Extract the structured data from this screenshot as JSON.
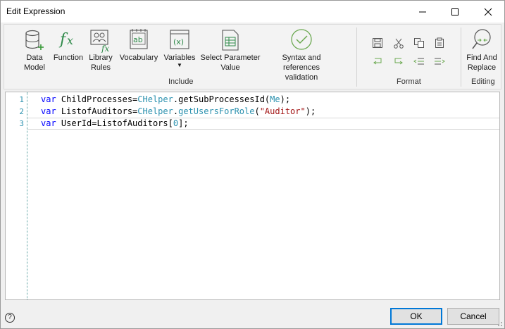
{
  "window": {
    "title": "Edit Expression"
  },
  "ribbon": {
    "include": {
      "group_label": "Include",
      "buttons": [
        {
          "label": "Data\nModel",
          "icon": "database-icon"
        },
        {
          "label": "Function",
          "icon": "function-fx-icon"
        },
        {
          "label": "Library\nRules",
          "icon": "library-rules-icon"
        },
        {
          "label": "Vocabulary",
          "icon": "vocabulary-icon"
        },
        {
          "label": "Variables",
          "icon": "variables-icon"
        },
        {
          "label": "Select Parameter\nValue",
          "icon": "select-parameter-icon"
        },
        {
          "label": "Syntax and references\nvalidation",
          "icon": "validation-check-icon"
        }
      ]
    },
    "format": {
      "group_label": "Format",
      "icons": [
        "save-icon",
        "cut-icon",
        "copy-icon",
        "paste-icon",
        "undo-icon",
        "redo-icon",
        "outdent-icon",
        "indent-icon"
      ]
    },
    "editing": {
      "group_label": "Editing",
      "find_label": "Find And\nReplace"
    }
  },
  "editor": {
    "lines": [
      {
        "number": "1",
        "segments": [
          {
            "t": "var",
            "c": "kw"
          },
          {
            "t": " ChildProcesses=",
            "c": "fn"
          },
          {
            "t": "CHelper",
            "c": "cls"
          },
          {
            "t": ".",
            "c": "fn"
          },
          {
            "t": "getSubProcessesId",
            "c": "fn"
          },
          {
            "t": "(",
            "c": "fn"
          },
          {
            "t": "Me",
            "c": "cls"
          },
          {
            "t": ");",
            "c": "fn"
          }
        ]
      },
      {
        "number": "2",
        "segments": [
          {
            "t": "var",
            "c": "kw"
          },
          {
            "t": " ListofAuditors=",
            "c": "fn"
          },
          {
            "t": "CHelper",
            "c": "cls"
          },
          {
            "t": ".",
            "c": "fn"
          },
          {
            "t": "getUsersForRole",
            "c": "cls"
          },
          {
            "t": "(",
            "c": "fn"
          },
          {
            "t": "\"Auditor\"",
            "c": "str"
          },
          {
            "t": ");",
            "c": "fn"
          }
        ]
      },
      {
        "number": "3",
        "segments": [
          {
            "t": "var",
            "c": "kw"
          },
          {
            "t": " UserId=ListofAuditors[",
            "c": "fn"
          },
          {
            "t": "0",
            "c": "cls"
          },
          {
            "t": "];",
            "c": "fn"
          }
        ]
      }
    ]
  },
  "footer": {
    "help": "?",
    "ok_label": "OK",
    "cancel_label": "Cancel"
  }
}
